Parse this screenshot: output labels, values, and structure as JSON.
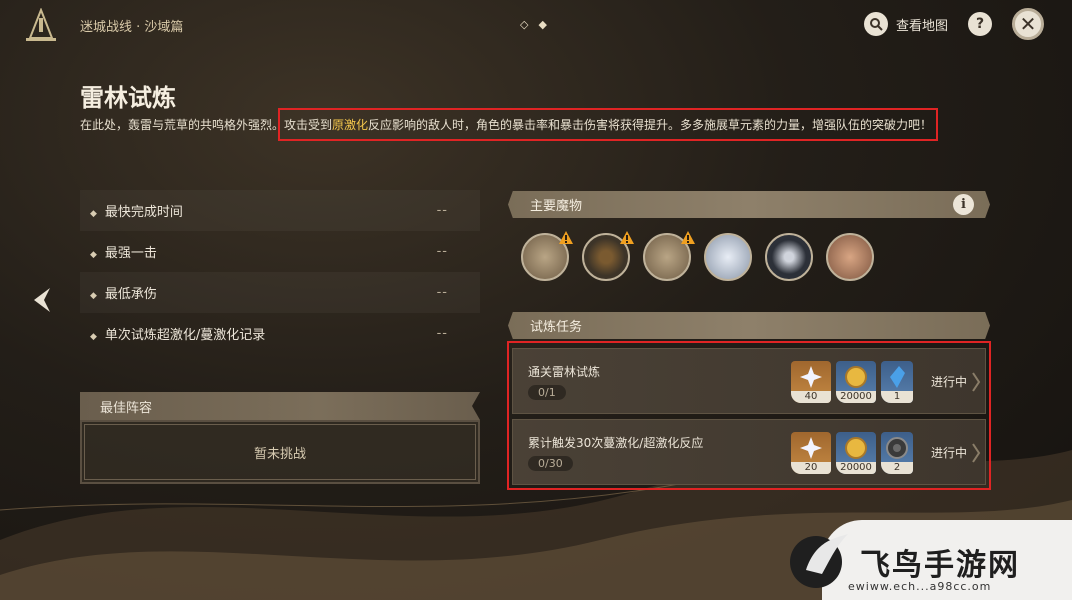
{
  "header": {
    "breadcrumb": "迷城战线 · 沙域篇",
    "pager": [
      "◇",
      "◆"
    ],
    "map_label": "查看地图",
    "help_label": "?",
    "close_label": "✕"
  },
  "page": {
    "title": "雷林试炼",
    "desc_prefix": "在此处，轰雷与荒草的共鸣格外强烈。",
    "desc_a": "攻击受到",
    "desc_highlight": "原激化",
    "desc_b": "反应影响的敌人时，角色的暴击率和暴击伤害将获得提升。多多施展草元素的力量，增强队伍的突破力吧！",
    "highlight_color": "#f5c84c"
  },
  "stats": [
    {
      "label": "最快完成时间",
      "value": "--"
    },
    {
      "label": "最强一击",
      "value": "--"
    },
    {
      "label": "最低承伤",
      "value": "--"
    },
    {
      "label": "单次试炼超激化/蔓激化记录",
      "value": "--"
    }
  ],
  "lineup": {
    "header": "最佳阵容",
    "empty_text": "暂未挑战"
  },
  "monsters_section": {
    "header": "主要魔物",
    "info_label": "i",
    "monsters": [
      {
        "icon": "ruin-drake-icon",
        "warning": true
      },
      {
        "icon": "ruin-sentinel-icon",
        "warning": true
      },
      {
        "icon": "ruin-drake-icon",
        "warning": true
      },
      {
        "icon": "primal-construct-icon",
        "warning": false
      },
      {
        "icon": "primal-construct-dark-icon",
        "warning": false
      },
      {
        "icon": "shaman-mask-icon",
        "warning": false
      }
    ]
  },
  "tasks_section": {
    "header": "试炼任务",
    "tasks": [
      {
        "name": "通关雷林试炼",
        "progress": "0/1",
        "status": "进行中",
        "rewards": [
          {
            "icon": "primogem-icon",
            "count": "40"
          },
          {
            "icon": "mora-icon",
            "count": "20000"
          },
          {
            "icon": "electro-crystal-icon",
            "count": "1"
          }
        ]
      },
      {
        "name": "累计触发30次蔓激化/超激化反应",
        "progress": "0/30",
        "status": "进行中",
        "rewards": [
          {
            "icon": "primogem-icon",
            "count": "20"
          },
          {
            "icon": "mora-icon",
            "count": "20000"
          },
          {
            "icon": "cog-material-icon",
            "count": "2"
          }
        ]
      }
    ]
  },
  "watermark": {
    "text": "飞鸟手游网",
    "sub": "ewiww.ech...a98cc.om"
  }
}
